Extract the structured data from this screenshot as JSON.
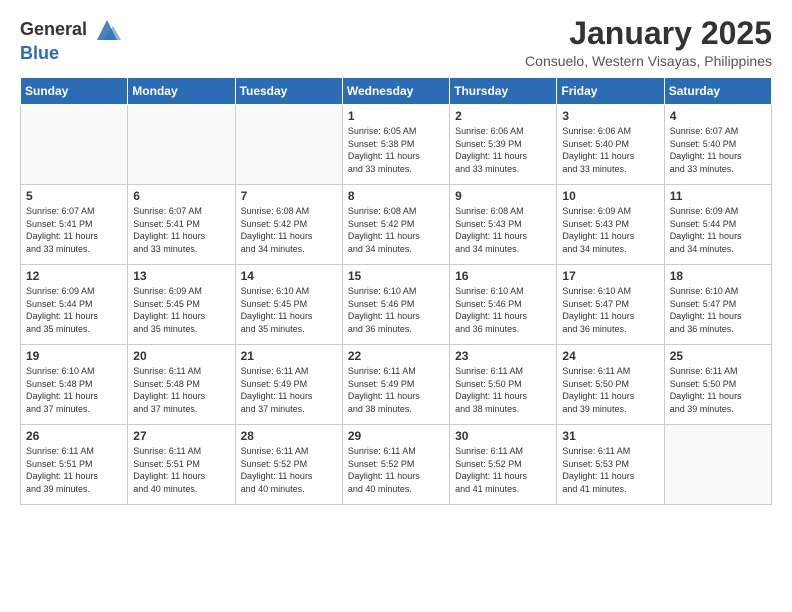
{
  "logo": {
    "line1": "General",
    "line2": "Blue"
  },
  "title": "January 2025",
  "subtitle": "Consuelo, Western Visayas, Philippines",
  "weekdays": [
    "Sunday",
    "Monday",
    "Tuesday",
    "Wednesday",
    "Thursday",
    "Friday",
    "Saturday"
  ],
  "weeks": [
    [
      {
        "day": "",
        "info": ""
      },
      {
        "day": "",
        "info": ""
      },
      {
        "day": "",
        "info": ""
      },
      {
        "day": "1",
        "info": "Sunrise: 6:05 AM\nSunset: 5:38 PM\nDaylight: 11 hours\nand 33 minutes."
      },
      {
        "day": "2",
        "info": "Sunrise: 6:06 AM\nSunset: 5:39 PM\nDaylight: 11 hours\nand 33 minutes."
      },
      {
        "day": "3",
        "info": "Sunrise: 6:06 AM\nSunset: 5:40 PM\nDaylight: 11 hours\nand 33 minutes."
      },
      {
        "day": "4",
        "info": "Sunrise: 6:07 AM\nSunset: 5:40 PM\nDaylight: 11 hours\nand 33 minutes."
      }
    ],
    [
      {
        "day": "5",
        "info": "Sunrise: 6:07 AM\nSunset: 5:41 PM\nDaylight: 11 hours\nand 33 minutes."
      },
      {
        "day": "6",
        "info": "Sunrise: 6:07 AM\nSunset: 5:41 PM\nDaylight: 11 hours\nand 33 minutes."
      },
      {
        "day": "7",
        "info": "Sunrise: 6:08 AM\nSunset: 5:42 PM\nDaylight: 11 hours\nand 34 minutes."
      },
      {
        "day": "8",
        "info": "Sunrise: 6:08 AM\nSunset: 5:42 PM\nDaylight: 11 hours\nand 34 minutes."
      },
      {
        "day": "9",
        "info": "Sunrise: 6:08 AM\nSunset: 5:43 PM\nDaylight: 11 hours\nand 34 minutes."
      },
      {
        "day": "10",
        "info": "Sunrise: 6:09 AM\nSunset: 5:43 PM\nDaylight: 11 hours\nand 34 minutes."
      },
      {
        "day": "11",
        "info": "Sunrise: 6:09 AM\nSunset: 5:44 PM\nDaylight: 11 hours\nand 34 minutes."
      }
    ],
    [
      {
        "day": "12",
        "info": "Sunrise: 6:09 AM\nSunset: 5:44 PM\nDaylight: 11 hours\nand 35 minutes."
      },
      {
        "day": "13",
        "info": "Sunrise: 6:09 AM\nSunset: 5:45 PM\nDaylight: 11 hours\nand 35 minutes."
      },
      {
        "day": "14",
        "info": "Sunrise: 6:10 AM\nSunset: 5:45 PM\nDaylight: 11 hours\nand 35 minutes."
      },
      {
        "day": "15",
        "info": "Sunrise: 6:10 AM\nSunset: 5:46 PM\nDaylight: 11 hours\nand 36 minutes."
      },
      {
        "day": "16",
        "info": "Sunrise: 6:10 AM\nSunset: 5:46 PM\nDaylight: 11 hours\nand 36 minutes."
      },
      {
        "day": "17",
        "info": "Sunrise: 6:10 AM\nSunset: 5:47 PM\nDaylight: 11 hours\nand 36 minutes."
      },
      {
        "day": "18",
        "info": "Sunrise: 6:10 AM\nSunset: 5:47 PM\nDaylight: 11 hours\nand 36 minutes."
      }
    ],
    [
      {
        "day": "19",
        "info": "Sunrise: 6:10 AM\nSunset: 5:48 PM\nDaylight: 11 hours\nand 37 minutes."
      },
      {
        "day": "20",
        "info": "Sunrise: 6:11 AM\nSunset: 5:48 PM\nDaylight: 11 hours\nand 37 minutes."
      },
      {
        "day": "21",
        "info": "Sunrise: 6:11 AM\nSunset: 5:49 PM\nDaylight: 11 hours\nand 37 minutes."
      },
      {
        "day": "22",
        "info": "Sunrise: 6:11 AM\nSunset: 5:49 PM\nDaylight: 11 hours\nand 38 minutes."
      },
      {
        "day": "23",
        "info": "Sunrise: 6:11 AM\nSunset: 5:50 PM\nDaylight: 11 hours\nand 38 minutes."
      },
      {
        "day": "24",
        "info": "Sunrise: 6:11 AM\nSunset: 5:50 PM\nDaylight: 11 hours\nand 39 minutes."
      },
      {
        "day": "25",
        "info": "Sunrise: 6:11 AM\nSunset: 5:50 PM\nDaylight: 11 hours\nand 39 minutes."
      }
    ],
    [
      {
        "day": "26",
        "info": "Sunrise: 6:11 AM\nSunset: 5:51 PM\nDaylight: 11 hours\nand 39 minutes."
      },
      {
        "day": "27",
        "info": "Sunrise: 6:11 AM\nSunset: 5:51 PM\nDaylight: 11 hours\nand 40 minutes."
      },
      {
        "day": "28",
        "info": "Sunrise: 6:11 AM\nSunset: 5:52 PM\nDaylight: 11 hours\nand 40 minutes."
      },
      {
        "day": "29",
        "info": "Sunrise: 6:11 AM\nSunset: 5:52 PM\nDaylight: 11 hours\nand 40 minutes."
      },
      {
        "day": "30",
        "info": "Sunrise: 6:11 AM\nSunset: 5:52 PM\nDaylight: 11 hours\nand 41 minutes."
      },
      {
        "day": "31",
        "info": "Sunrise: 6:11 AM\nSunset: 5:53 PM\nDaylight: 11 hours\nand 41 minutes."
      },
      {
        "day": "",
        "info": ""
      }
    ]
  ]
}
